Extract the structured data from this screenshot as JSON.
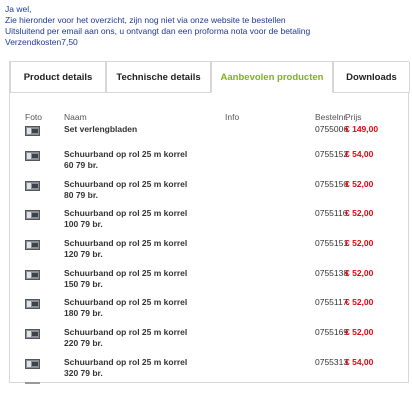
{
  "intro": {
    "line1": "Ja wel,",
    "line2": "Zie hieronder voor het overzicht, zijn nog niet via onze website te bestellen",
    "line3": "Uitsluitend per email aan ons, u ontvangt dan een proforma nota voor de betaling",
    "line4": "Verzendkosten7,50"
  },
  "tabs": [
    {
      "label": "Product details"
    },
    {
      "label": "Technische details"
    },
    {
      "label": "Aanbevolen producten"
    },
    {
      "label": "Downloads"
    }
  ],
  "table": {
    "headers": {
      "foto": "Foto",
      "naam": "Naam",
      "info": "Info",
      "bestelnr": "Bestelnr.",
      "prijs": "Prijs"
    },
    "rows": [
      {
        "name_line1": "Set verlengbladen",
        "name_line2": "",
        "artno": "0755006",
        "price": "€ 149,00"
      },
      {
        "name_line1": "Schuurband op rol 25 m korrel",
        "name_line2": "60 79 br.",
        "artno": "0755152",
        "price": "€ 54,00"
      },
      {
        "name_line1": "Schuurband op rol 25 m korrel",
        "name_line2": "80 79 br.",
        "artno": "0755150",
        "price": "€ 52,00"
      },
      {
        "name_line1": "Schuurband op rol 25 m korrel",
        "name_line2": "100 79 br.",
        "artno": "0755116",
        "price": "€ 52,00"
      },
      {
        "name_line1": "Schuurband op rol 25 m korrel",
        "name_line2": "120 79 br.",
        "artno": "0755151",
        "price": "€ 52,00"
      },
      {
        "name_line1": "Schuurband op rol 25 m korrel",
        "name_line2": "150 79 br.",
        "artno": "0755138",
        "price": "€ 52,00"
      },
      {
        "name_line1": "Schuurband op rol 25 m korrel",
        "name_line2": "180 79 br.",
        "artno": "0755117",
        "price": "€ 52,00"
      },
      {
        "name_line1": "Schuurband op rol 25 m korrel",
        "name_line2": "220 79 br.",
        "artno": "0755169",
        "price": "€ 52,00"
      },
      {
        "name_line1": "Schuurband op rol 25 m korrel",
        "name_line2": "320 79 br.",
        "artno": "0755313",
        "price": "€ 54,00"
      }
    ]
  },
  "icons": {
    "thumbnail": "product-thumbnail-icon"
  },
  "colors": {
    "intro_text": "#1f3a93",
    "active_tab": "#7fb21a",
    "price": "#e30613"
  }
}
